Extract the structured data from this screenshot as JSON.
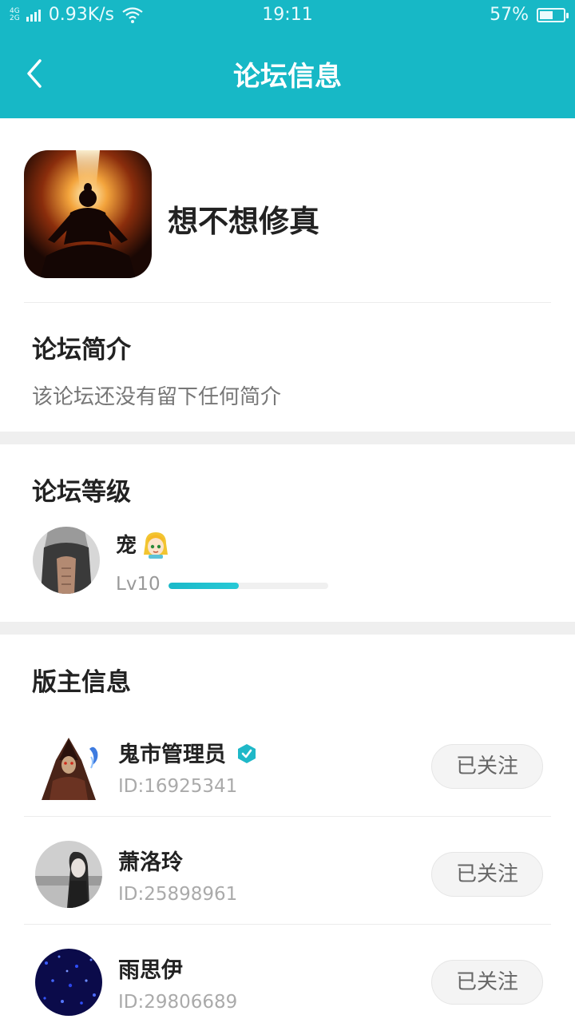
{
  "status_bar": {
    "network_top": "4G",
    "network_bottom": "2G",
    "speed": "0.93K/s",
    "time": "19:11",
    "battery": "57%",
    "battery_level": 0.57
  },
  "header": {
    "title": "论坛信息",
    "back_icon": "back-arrow-icon",
    "background_color": "#17b8c6"
  },
  "forum": {
    "name": "想不想修真"
  },
  "intro": {
    "title": "论坛简介",
    "text": "该论坛还没有留下任何简介"
  },
  "level": {
    "title": "论坛等级",
    "user_name": "宠",
    "level_label": "Lv10",
    "progress": 0.44
  },
  "moderators": {
    "title": "版主信息",
    "items": [
      {
        "name": "鬼市管理员",
        "id": "ID:16925341",
        "verified": true,
        "button": "已关注"
      },
      {
        "name": "萧洛玲",
        "id": "ID:25898961",
        "verified": false,
        "button": "已关注"
      },
      {
        "name": "雨思伊",
        "id": "ID:29806689",
        "verified": false,
        "button": "已关注"
      }
    ]
  },
  "colors": {
    "accent": "#17b8c6",
    "progress": "#19b9c9",
    "verified": "#1fb8c8"
  }
}
